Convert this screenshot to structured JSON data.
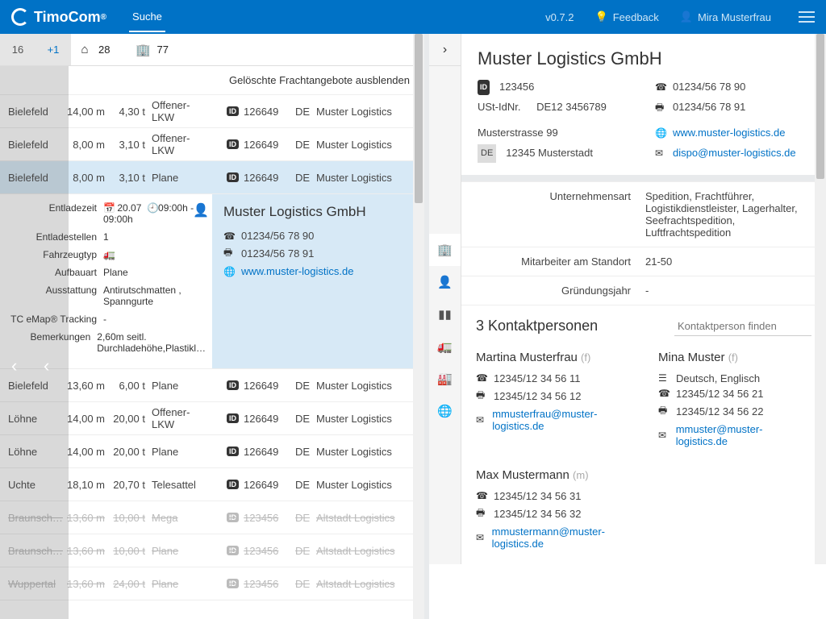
{
  "header": {
    "brand": "TimoCom",
    "nav_search": "Suche",
    "version": "v0.7.2",
    "feedback": "Feedback",
    "user": "Mira Musterfrau"
  },
  "left": {
    "tabs": {
      "n16": "16",
      "plus1": "+1",
      "n28": "28",
      "n77": "77"
    },
    "filter": "Gelöschte Frachtangebote ausblenden",
    "rows": [
      {
        "city": "Bielefeld",
        "m": "14,00 m",
        "t": "4,30 t",
        "type": "Offener-LKW",
        "id": "126649",
        "cc": "DE",
        "co": "Muster Logistics",
        "dim": false,
        "sel": false
      },
      {
        "city": "Bielefeld",
        "m": "8,00 m",
        "t": "3,10 t",
        "type": "Offener-LKW",
        "id": "126649",
        "cc": "DE",
        "co": "Muster Logistics",
        "dim": false,
        "sel": false
      },
      {
        "city": "Bielefeld",
        "m": "8,00 m",
        "t": "3,10 t",
        "type": "Plane",
        "id": "126649",
        "cc": "DE",
        "co": "Muster Logistics",
        "dim": false,
        "sel": true
      },
      {
        "city": "Bielefeld",
        "m": "13,60 m",
        "t": "6,00 t",
        "type": "Plane",
        "id": "126649",
        "cc": "DE",
        "co": "Muster Logistics",
        "dim": false,
        "sel": false
      },
      {
        "city": "Löhne",
        "m": "14,00 m",
        "t": "20,00 t",
        "type": "Offener-LKW",
        "id": "126649",
        "cc": "DE",
        "co": "Muster Logistics",
        "dim": false,
        "sel": false
      },
      {
        "city": "Löhne",
        "m": "14,00 m",
        "t": "20,00 t",
        "type": "Plane",
        "id": "126649",
        "cc": "DE",
        "co": "Muster Logistics",
        "dim": false,
        "sel": false
      },
      {
        "city": "Uchte",
        "m": "18,10 m",
        "t": "20,70 t",
        "type": "Telesattel",
        "id": "126649",
        "cc": "DE",
        "co": "Muster Logistics",
        "dim": false,
        "sel": false
      },
      {
        "city": "Braunsch…",
        "m": "13,60 m",
        "t": "10,00 t",
        "type": "Mega",
        "id": "123456",
        "cc": "DE",
        "co": "Altstadt Logistics",
        "dim": true,
        "sel": false
      },
      {
        "city": "Braunsch…",
        "m": "13,60 m",
        "t": "10,00 t",
        "type": "Plane",
        "id": "123456",
        "cc": "DE",
        "co": "Altstadt Logistics",
        "dim": true,
        "sel": false
      },
      {
        "city": "Wuppertal",
        "m": "13,60 m",
        "t": "24,00 t",
        "type": "Plane",
        "id": "123456",
        "cc": "DE",
        "co": "Altstadt Logistics",
        "dim": true,
        "sel": false
      }
    ],
    "expand": {
      "labels": {
        "entladezeit": "Entladezeit",
        "entladestellen": "Entladestellen",
        "fahrzeugtyp": "Fahrzeugtyp",
        "aufbauart": "Aufbauart",
        "ausstattung": "Ausstattung",
        "tracking": "TC eMap® Tracking",
        "bemerkungen": "Bemerkungen"
      },
      "vals": {
        "entladezeit": "20.07",
        "entladezeit2": "09:00h - 09:00h",
        "entladestellen": "1",
        "aufbauart": "Plane",
        "ausstattung": "Antirutschmatten , Spanngurte",
        "tracking": "-",
        "bemerkungen": "2,60m seitl. Durchladehöhe,Plastikl…"
      },
      "company": {
        "name": "Muster Logistics GmbH",
        "phone": "01234/56 78 90",
        "fax": "01234/56 78 91",
        "url": "www.muster-logistics.de"
      }
    }
  },
  "right": {
    "company": {
      "name": "Muster Logistics GmbH",
      "id": "123456",
      "ust_label": "USt-IdNr.",
      "ust": "DE12 3456789",
      "street": "Musterstrasse 99",
      "cc": "DE",
      "city": "12345 Musterstadt",
      "phone": "01234/56 78 90",
      "fax": "01234/56 78 91",
      "url": "www.muster-logistics.de",
      "email": "dispo@muster-logistics.de"
    },
    "details": {
      "art_l": "Unternehmensart",
      "art_v": "Spedition, Frachtführer, Logistikdienstleister, Lagerhalter, Seefrachtspedition, Luftfrachtspedition",
      "mit_l": "Mitarbeiter am Standort",
      "mit_v": "21-50",
      "gru_l": "Gründungsjahr",
      "gru_v": "-"
    },
    "contacts": {
      "title": "3 Kontaktpersonen",
      "search_ph": "Kontaktperson finden",
      "list": [
        {
          "name": "Martina Musterfrau",
          "suf": "(f)",
          "phone": "12345/12 34 56 11",
          "fax": "12345/12 34 56 12",
          "email": "mmusterfrau@muster-logistics.de"
        },
        {
          "name": "Mina Muster",
          "suf": "(f)",
          "lang": "Deutsch, Englisch",
          "phone": "12345/12 34 56 21",
          "fax": "12345/12 34 56 22",
          "email": "mmuster@muster-logistics.de"
        },
        {
          "name": "Max Mustermann",
          "suf": "(m)",
          "phone": "12345/12 34 56 31",
          "fax": "12345/12 34 56 32",
          "email": "mmustermann@muster-logistics.de"
        }
      ]
    }
  }
}
